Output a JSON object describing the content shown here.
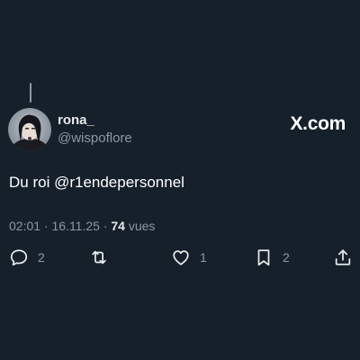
{
  "post": {
    "display_name": "rona_",
    "handle": "@wispoflore",
    "brand": "X.com",
    "text": "Du roi @r1endepersonnel",
    "timestamp": "02:01 · 16.11.25 · ",
    "views_count": "74",
    "views_label": " vues"
  },
  "actions": {
    "reply_count": "2",
    "retweet_count": "",
    "like_count": "1",
    "bookmark_count": "2"
  },
  "colors": {
    "background": "#15202b",
    "text_primary": "#e7e9ea",
    "text_secondary": "#8b98a5"
  },
  "icons": [
    "reply-icon",
    "retweet-icon",
    "like-icon",
    "bookmark-icon",
    "share-icon"
  ]
}
